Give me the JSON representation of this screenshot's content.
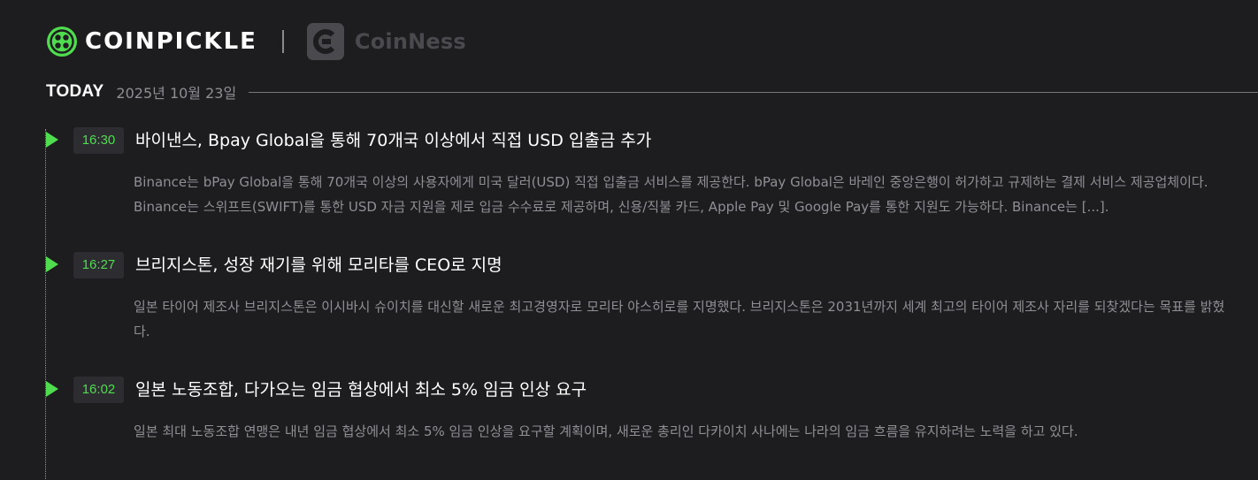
{
  "brand": {
    "primary_name": "COINPICKLE",
    "partner_name": "CoinNess"
  },
  "today": {
    "label": "TODAY",
    "date": "2025년 10월 23일"
  },
  "colors": {
    "background": "#1d1d20",
    "accent_green": "#4fdc4f",
    "badge_bg": "#2d2d31",
    "summary_text": "#8f8f94"
  },
  "news": [
    {
      "time": "16:30",
      "headline": "바이낸스, Bpay Global을 통해 70개국 이상에서 직접 USD 입출금 추가",
      "summary": "Binance는 bPay Global을 통해 70개국 이상의 사용자에게 미국 달러(USD) 직접 입출금 서비스를 제공한다. bPay Global은 바레인 중앙은행이 허가하고 규제하는 결제 서비스 제공업체이다. Binance는 스위프트(SWIFT)를 통한 USD 자금 지원을 제로 입금 수수료로 제공하며, 신용/직불 카드, Apple Pay 및 Google Pay를 통한 지원도 가능하다. Binance는 [...]."
    },
    {
      "time": "16:27",
      "headline": "브리지스톤, 성장 재기를 위해 모리타를 CEO로 지명",
      "summary": "일본 타이어 제조사 브리지스톤은 이시바시 슈이치를 대신할 새로운 최고경영자로 모리타 야스히로를 지명했다. 브리지스톤은 2031년까지 세계 최고의 타이어 제조사 자리를 되찾겠다는 목표를 밝혔다."
    },
    {
      "time": "16:02",
      "headline": "일본 노동조합, 다가오는 임금 협상에서 최소 5% 임금 인상 요구",
      "summary": "일본 최대 노동조합 연맹은 내년 임금 협상에서 최소 5% 임금 인상을 요구할 계획이며, 새로운 총리인 다카이치 사나에는 나라의 임금 흐름을 유지하려는 노력을 하고 있다."
    }
  ]
}
